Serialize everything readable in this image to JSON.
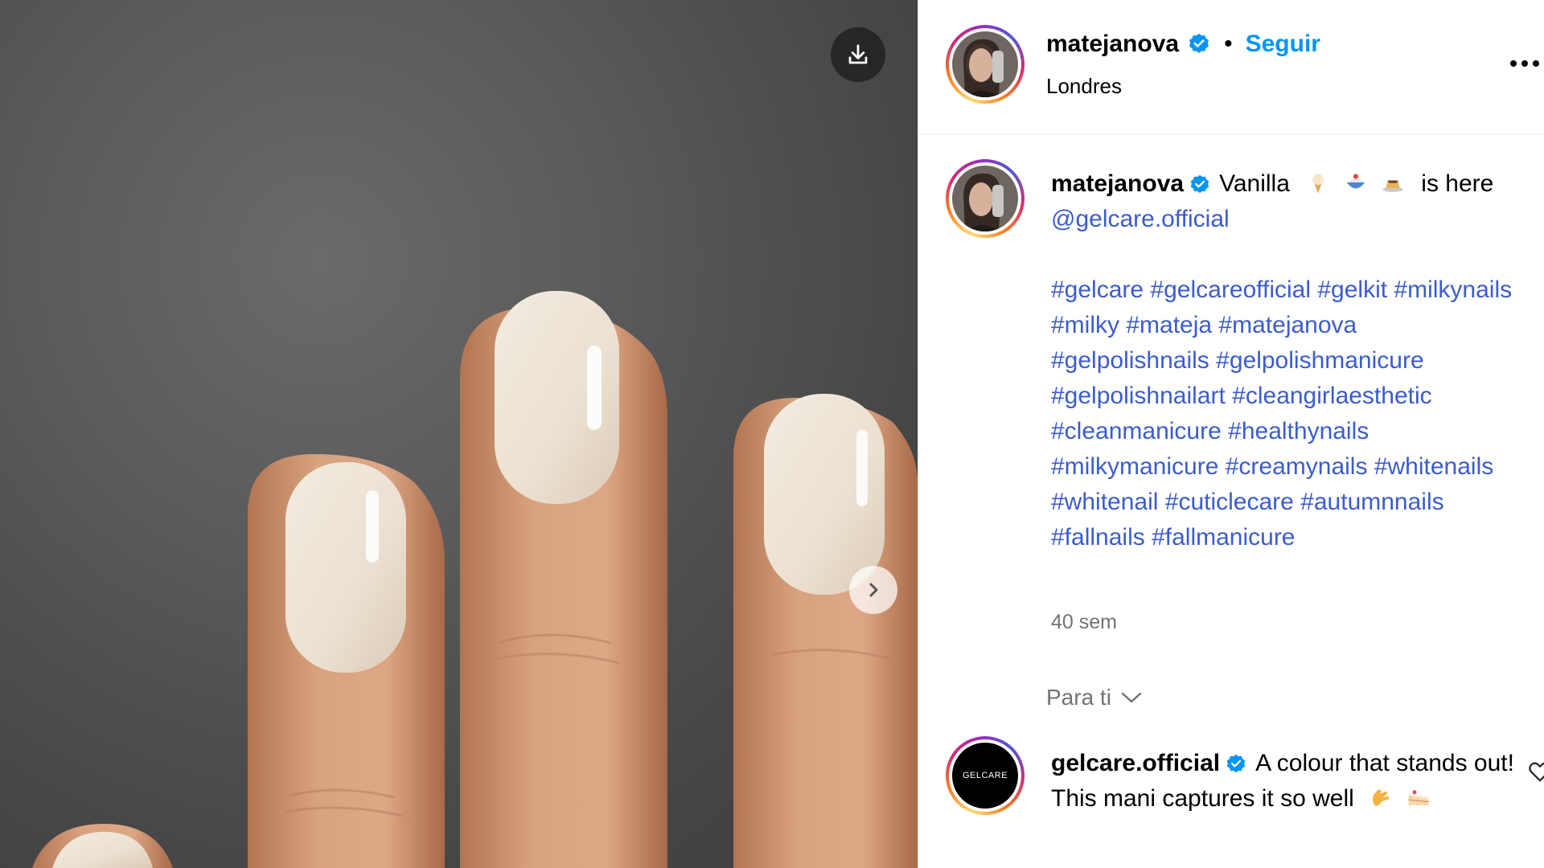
{
  "media": {
    "download_icon": "download-icon",
    "next_icon": "chevron-right-icon"
  },
  "post": {
    "author": "matejanova",
    "verified_icon": "verified-badge-icon",
    "separator": "•",
    "follow_label": "Seguir",
    "location": "Londres",
    "more_icon": "more-horizontal-icon"
  },
  "caption": {
    "author": "matejanova",
    "text_before": "Vanilla",
    "emojis": [
      "ice-cream-emoji",
      "shaved-ice-emoji",
      "custard-emoji"
    ],
    "text_after": "is here",
    "mention": "@gelcare.official",
    "hashtags": [
      "#gelcare",
      "#gelcareofficial",
      "#gelkit",
      "#milkynails",
      "#milky",
      "#mateja",
      "#matejanova",
      "#gelpolishnails",
      "#gelpolishmanicure",
      "#gelpolishnailart",
      "#cleangirlaesthetic",
      "#cleanmanicure",
      "#healthynails",
      "#milkymanicure",
      "#creamynails",
      "#whitenails",
      "#whitenail",
      "#cuticlecare",
      "#autumnnails",
      "#fallnails",
      "#fallmanicure"
    ],
    "time": "40 sem"
  },
  "comments_filter": {
    "label": "Para ti",
    "icon": "chevron-down-icon"
  },
  "comment": {
    "author": "gelcare.official",
    "avatar_text": "GELCARE",
    "text": "A colour that stands out! This mani captures it so well",
    "emojis": [
      "clapping-hands-emoji",
      "cake-emoji"
    ],
    "like_icon": "heart-icon"
  },
  "colors": {
    "accent": "#0095f6",
    "link": "#3b5ccf",
    "verified": "#0095f6",
    "secondary_text": "#737373"
  }
}
